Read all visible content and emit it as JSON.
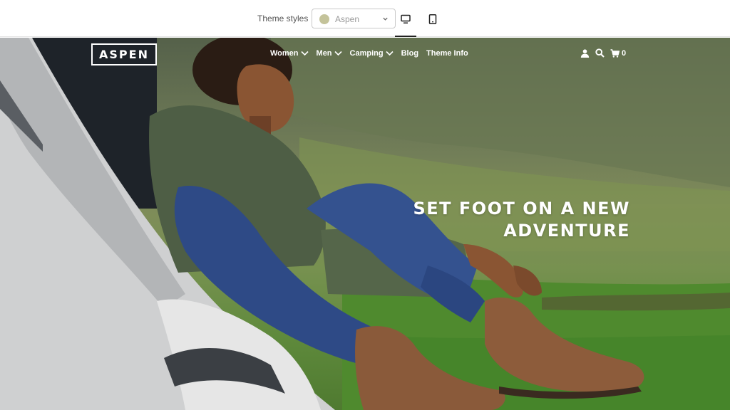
{
  "toolbar": {
    "theme_styles_label": "Theme styles",
    "selected_style": "Aspen",
    "swatch_color": "#c4c39a",
    "chevron_icon": "chevron-down-icon",
    "device_buttons": [
      {
        "icon": "desktop-icon",
        "active": true
      },
      {
        "icon": "mobile-icon",
        "active": false
      }
    ]
  },
  "store": {
    "logo": "ASPEN",
    "nav": [
      {
        "label": "Women",
        "has_dropdown": true
      },
      {
        "label": "Men",
        "has_dropdown": true
      },
      {
        "label": "Camping",
        "has_dropdown": true
      },
      {
        "label": "Blog",
        "has_dropdown": false
      },
      {
        "label": "Theme Info",
        "has_dropdown": false
      }
    ],
    "header_icons": [
      "account-icon",
      "search-icon",
      "cart-icon"
    ],
    "cart_count": "0"
  },
  "hero": {
    "headline_line1": "SET FOOT ON A NEW",
    "headline_line2": "ADVENTURE"
  }
}
